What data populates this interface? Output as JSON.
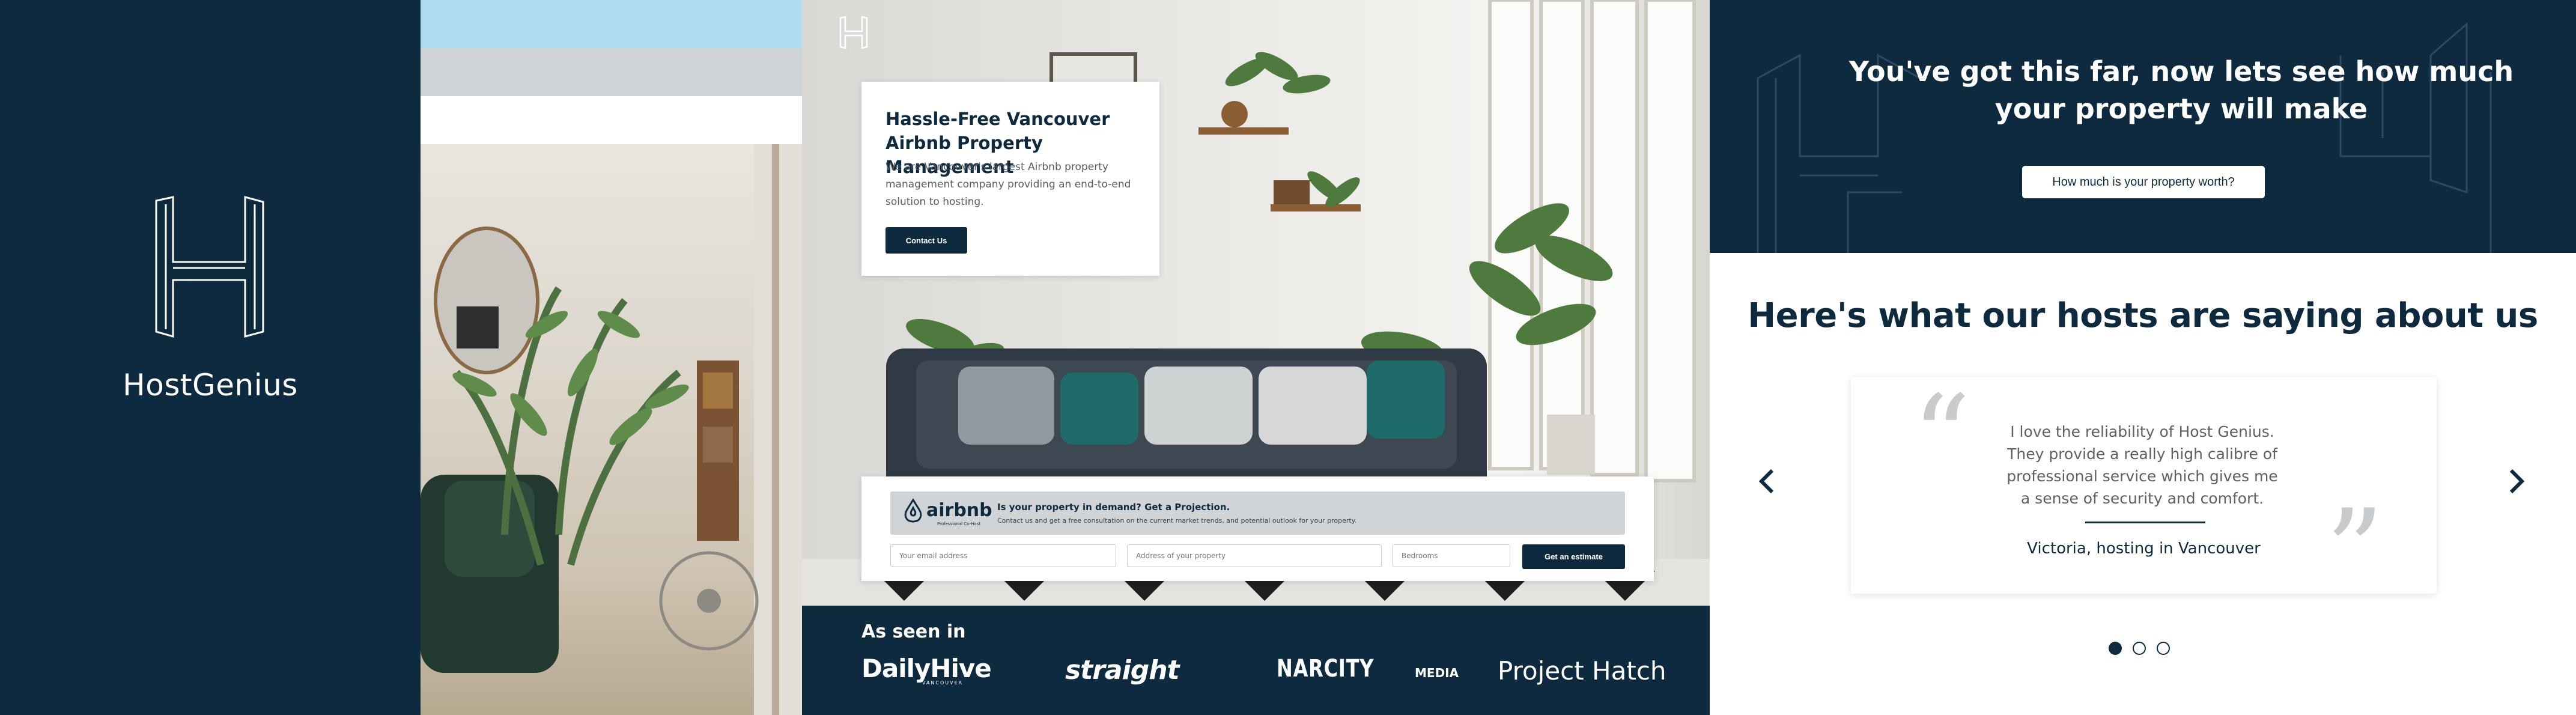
{
  "brand": {
    "name": "HostGenius"
  },
  "hero": {
    "title": "Hassle-Free Vancouver Airbnb Property Management",
    "description": "We are Vancouver's largest Airbnb property management company providing an end-to-end solution to hosting.",
    "contact_button": "Contact Us"
  },
  "estimate": {
    "airbnb_logo_text": "airbnb",
    "airbnb_badge": "Professional Co-Host",
    "heading": "Is your property in demand? Get a Projection.",
    "subtext": "Contact us and get a free consultation on the current market trends, and potential outlook for your property.",
    "email_placeholder": "Your email address",
    "address_placeholder": "Address of your property",
    "bedrooms_placeholder": "Bedrooms",
    "submit_button": "Get an estimate"
  },
  "press": {
    "label": "As seen in",
    "logos": {
      "dailyhive": "DailyHive",
      "dailyhive_sub": "VANCOUVER",
      "straight": "straight",
      "narcity": "NARCITY",
      "narcity_media": "MEDIA",
      "hatch": "Project Hatch"
    }
  },
  "cta": {
    "heading": "You've got this far, now lets see how much your property will make",
    "button": "How much is your property worth?"
  },
  "testimonials": {
    "heading": "Here's what our hosts are saying about us",
    "quote": "I love the reliability of Host Genius. They provide a really high calibre of professional service which gives me a sense of security and comfort.",
    "author": "Victoria, hosting in Vancouver",
    "active_slide": 1,
    "total_slides": 3
  },
  "colors": {
    "navy": "#0d2a3f",
    "white": "#ffffff",
    "gray_quote": "#c7cbce"
  }
}
